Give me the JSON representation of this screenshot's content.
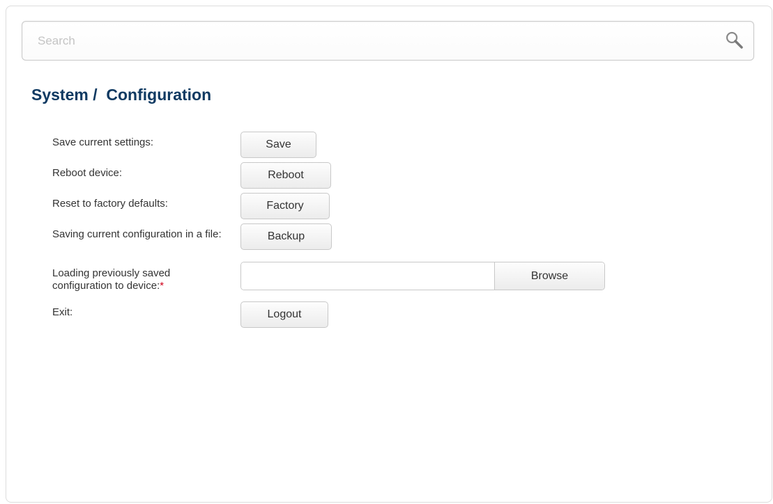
{
  "search": {
    "placeholder": "Search",
    "icon": "search-icon"
  },
  "page": {
    "title": "System /  Configuration"
  },
  "rows": {
    "save": {
      "label": "Save current settings:",
      "button": "Save"
    },
    "reboot": {
      "label": "Reboot device:",
      "button": "Reboot"
    },
    "factory": {
      "label": "Reset to factory defaults:",
      "button": "Factory"
    },
    "backup": {
      "label": "Saving current configuration in a file:",
      "button": "Backup"
    },
    "load": {
      "label": "Loading previously saved configuration to device:",
      "required_mark": "*",
      "browse": "Browse",
      "file_value": ""
    },
    "exit": {
      "label": "Exit:",
      "button": "Logout"
    }
  },
  "colors": {
    "title": "#103a62",
    "required": "#d0021b",
    "text": "#333333"
  }
}
